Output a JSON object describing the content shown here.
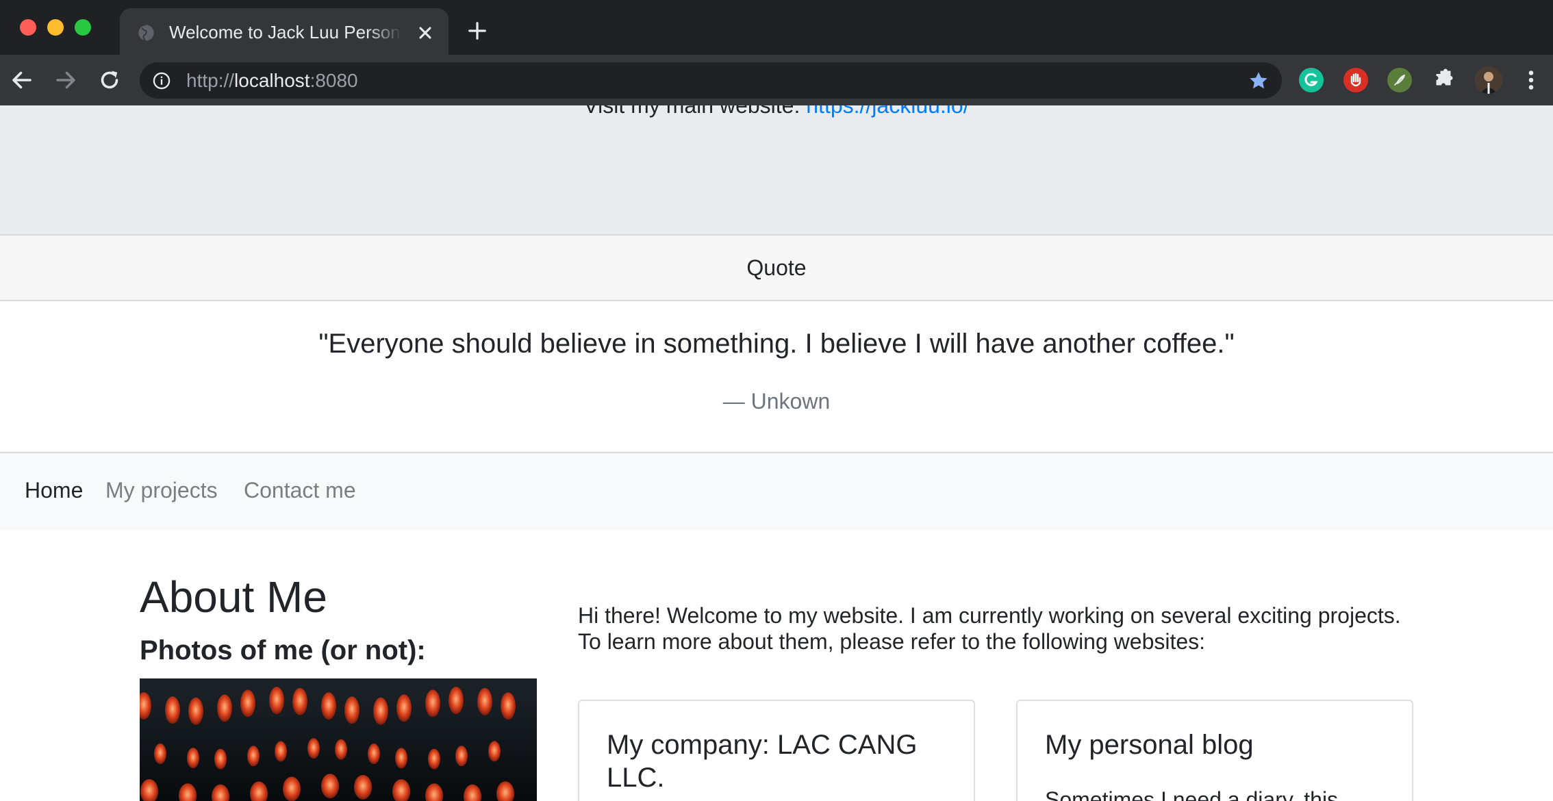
{
  "browser": {
    "tab_title": "Welcome to Jack Luu Personal",
    "url_scheme": "http://",
    "url_host": "localhost",
    "url_port": ":8080",
    "accent_star": "#8ab4f8"
  },
  "header": {
    "visit_label": "Visit my main website: ",
    "visit_link": "https://jackluu.io/"
  },
  "quote": {
    "header": "Quote",
    "text": "\"Everyone should believe in something. I believe I will have another coffee.\"",
    "author": "— Unkown"
  },
  "nav": {
    "items": [
      {
        "label": "Home",
        "active": true
      },
      {
        "label": "My projects",
        "active": false
      },
      {
        "label": "Contact me",
        "active": false
      }
    ]
  },
  "about": {
    "title": "About Me",
    "photos_title": "Photos of me (or not):",
    "intro": "Hi there! Welcome to my website. I am currently working on several exciting projects. To learn more about them, please refer to the following websites:"
  },
  "cards": [
    {
      "title": "My company: LAC CANG LLC.",
      "text": ""
    },
    {
      "title": "My personal blog",
      "text": "Sometimes I need a diary, this"
    }
  ],
  "colors": {
    "link": "#007bff",
    "jumbotron": "#e9ecef",
    "navbar": "#f8f9fa"
  }
}
